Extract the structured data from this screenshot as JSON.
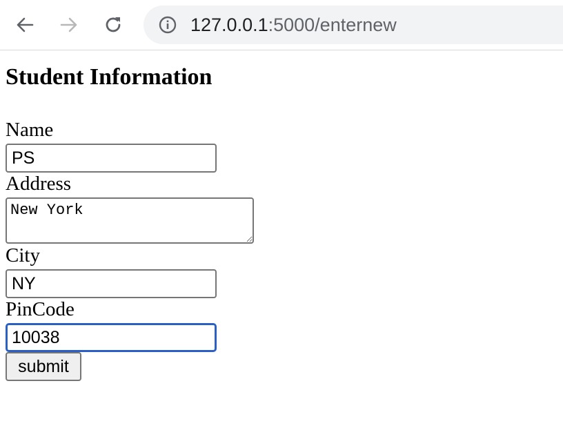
{
  "browser": {
    "url_host": "127.0.0.1",
    "url_path": ":5000/enternew",
    "icons": {
      "back": "arrow-left-icon",
      "forward": "arrow-right-icon",
      "reload": "reload-icon",
      "site_info": "info-icon"
    }
  },
  "page": {
    "title": "Student Information",
    "form": {
      "name_label": "Name",
      "name_value": "PS",
      "address_label": "Address",
      "address_value": "New York",
      "city_label": "City",
      "city_value": "NY",
      "pincode_label": "PinCode",
      "pincode_value": "10038",
      "submit_label": "submit"
    }
  },
  "colors": {
    "focus_ring": "#2a5fc4",
    "omnibox_bg": "#f1f3f4"
  }
}
